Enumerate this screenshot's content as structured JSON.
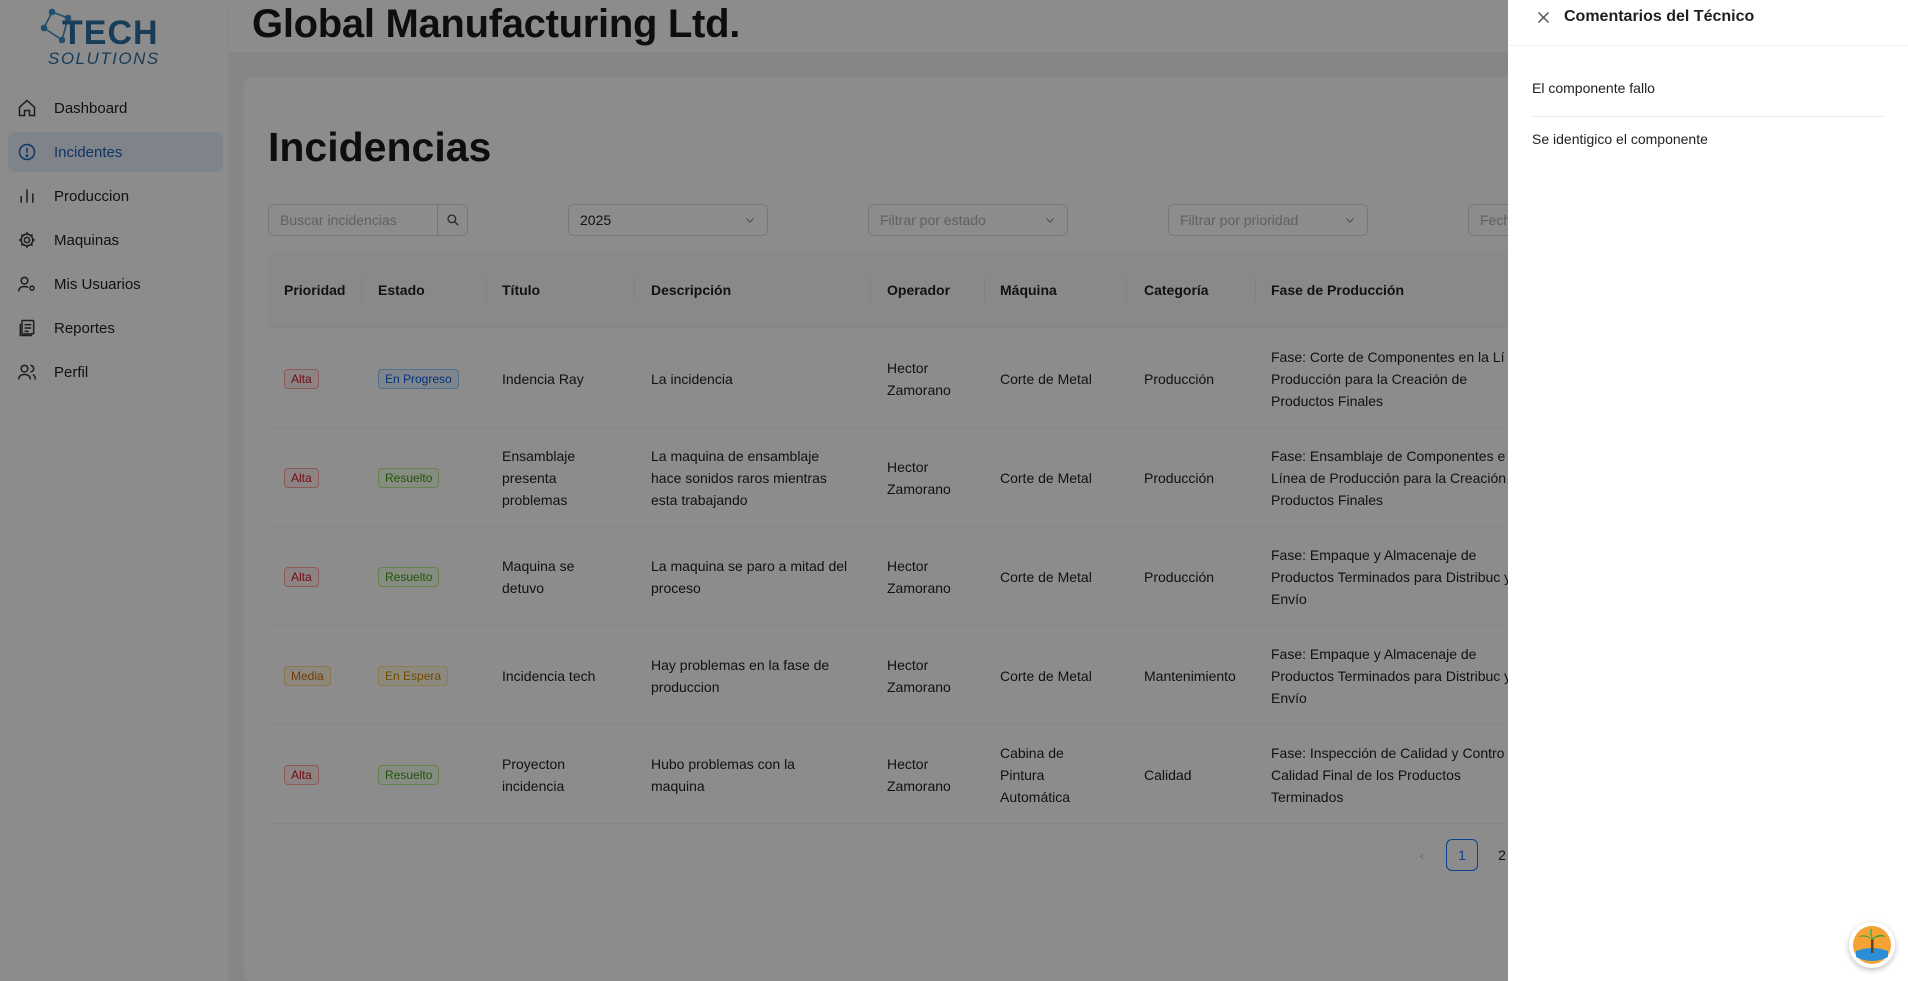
{
  "app": {
    "logo_text": "TECH SOLUTIONS",
    "company_title": "Global Manufacturing Ltd."
  },
  "sidebar": {
    "items": [
      {
        "label": "Dashboard",
        "icon": "home-icon",
        "active": false
      },
      {
        "label": "Incidentes",
        "icon": "alert-circle-icon",
        "active": true
      },
      {
        "label": "Produccion",
        "icon": "bar-chart-icon",
        "active": false
      },
      {
        "label": "Maquinas",
        "icon": "gear-icon",
        "active": false
      },
      {
        "label": "Mis Usuarios",
        "icon": "user-settings-icon",
        "active": false
      },
      {
        "label": "Reportes",
        "icon": "report-icon",
        "active": false
      },
      {
        "label": "Perfil",
        "icon": "users-icon",
        "active": false
      }
    ]
  },
  "main": {
    "title": "Incidencias",
    "filters": {
      "search_placeholder": "Buscar incidencias",
      "year_value": "2025",
      "status_placeholder": "Filtrar por estado",
      "priority_placeholder": "Filtrar por prioridad",
      "date_placeholder": "Fech"
    },
    "table": {
      "columns": [
        "Prioridad",
        "Estado",
        "Título",
        "Descripción",
        "Operador",
        "Máquina",
        "Categoría",
        "Fase de Producción"
      ],
      "rows": [
        {
          "priority": "Alta",
          "status": "En Progreso",
          "title": "Indencia Ray",
          "description": "La incidencia",
          "operator": "Hector Zamorano",
          "machine": "Corte de Metal",
          "category": "Producción",
          "phase": "Fase: Corte de Componentes en la Lí de Producción para la Creación de Productos Finales"
        },
        {
          "priority": "Alta",
          "status": "Resuelto",
          "title": "Ensamblaje presenta problemas",
          "description": "La maquina de ensamblaje hace sonidos raros mientras esta trabajando",
          "operator": "Hector Zamorano",
          "machine": "Corte de Metal",
          "category": "Producción",
          "phase": "Fase: Ensamblaje de Componentes e Línea de Producción para la Creación Productos Finales"
        },
        {
          "priority": "Alta",
          "status": "Resuelto",
          "title": "Maquina se detuvo",
          "description": "La maquina se paro a mitad del proceso",
          "operator": "Hector Zamorano",
          "machine": "Corte de Metal",
          "category": "Producción",
          "phase": "Fase: Empaque y Almacenaje de Productos Terminados para Distribuc y Envío"
        },
        {
          "priority": "Media",
          "status": "En Espera",
          "title": "Incidencia tech",
          "description": "Hay problemas en la fase de produccion",
          "operator": "Hector Zamorano",
          "machine": "Corte de Metal",
          "category": "Mantenimiento",
          "phase": "Fase: Empaque y Almacenaje de Productos Terminados para Distribuc y Envío"
        },
        {
          "priority": "Alta",
          "status": "Resuelto",
          "title": "Proyecton incidencia",
          "description": "Hubo problemas con la maquina",
          "operator": "Hector Zamorano",
          "machine": "Cabina de Pintura Automática",
          "category": "Calidad",
          "phase": "Fase: Inspección de Calidad y Contro Calidad Final de los Productos Terminados"
        }
      ]
    },
    "pagination": {
      "prev": "‹",
      "pages": [
        "1",
        "2"
      ],
      "current": "1"
    }
  },
  "drawer": {
    "title": "Comentarios del Técnico",
    "comments": [
      "El componente fallo",
      "Se identigico el componente"
    ]
  },
  "colors": {
    "accent": "#1677ff",
    "active_nav_bg": "#e6f0fb",
    "active_nav_text": "#1f5fb5"
  }
}
